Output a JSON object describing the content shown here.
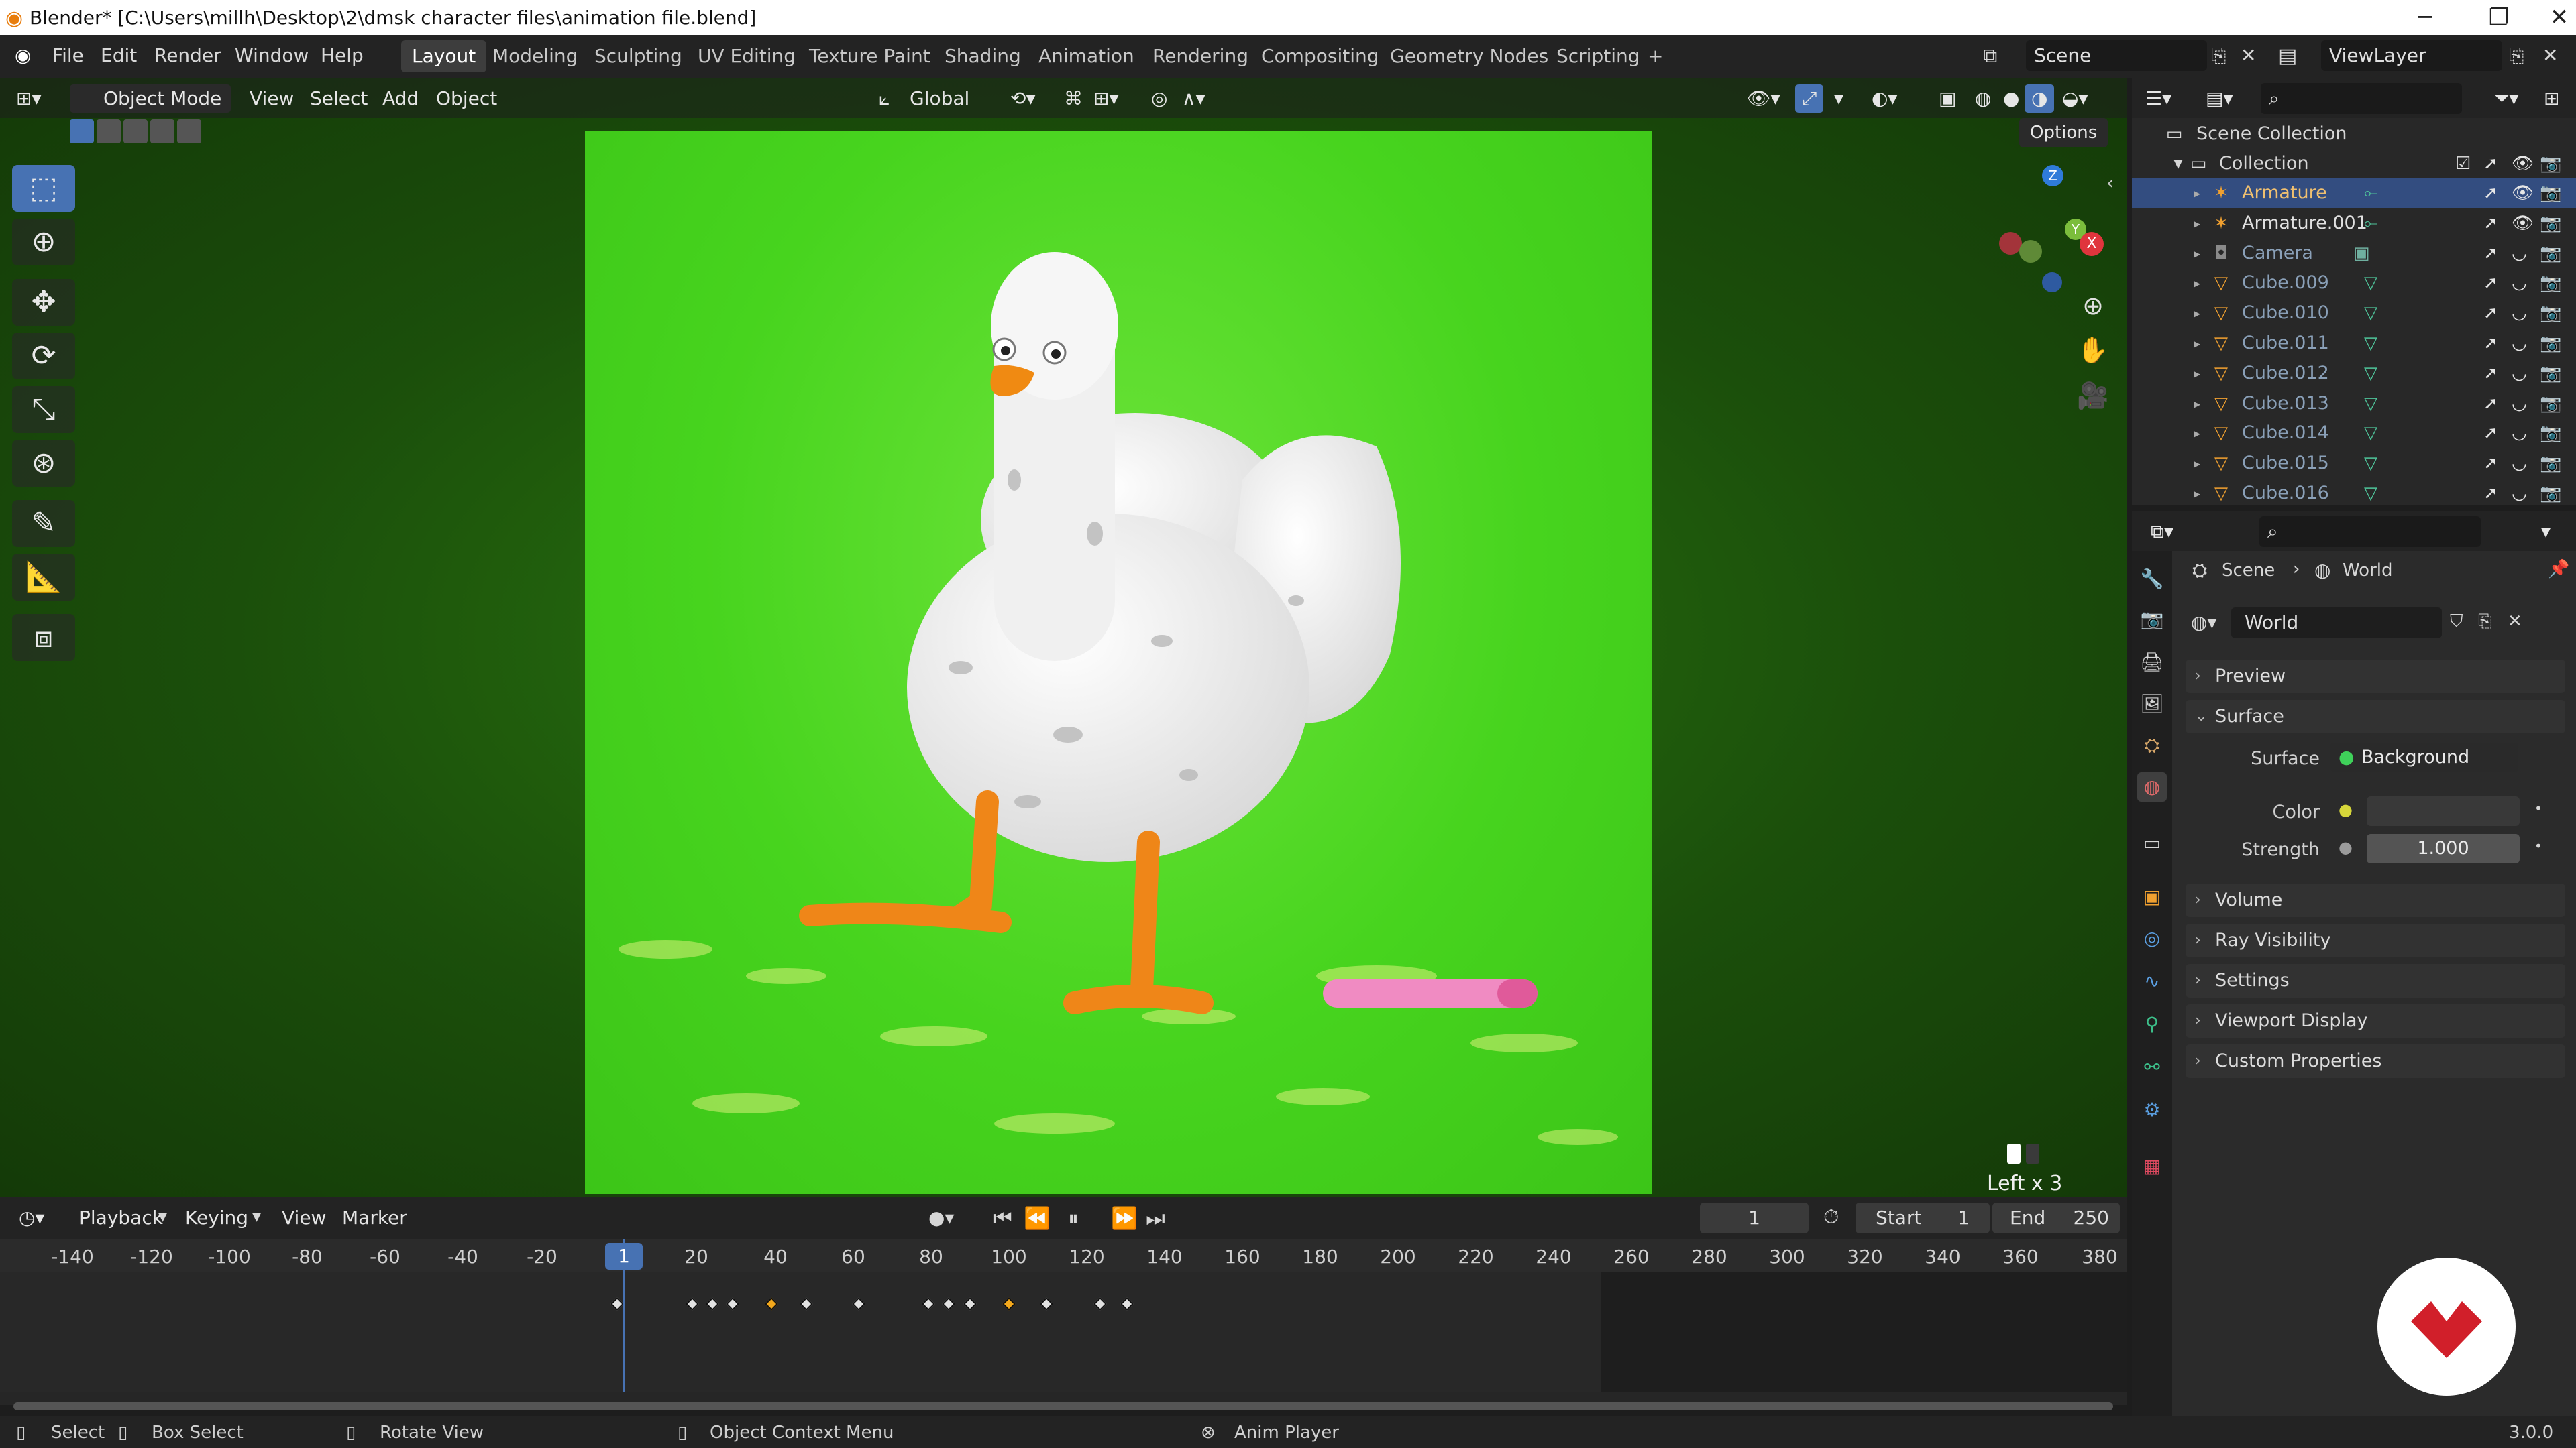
{
  "window": {
    "title": "Blender* [C:\\Users\\millh\\Desktop\\2\\dmsk character files\\animation file.blend]",
    "min": "─",
    "max": "❐",
    "close": "✕"
  },
  "menu": {
    "items": [
      "File",
      "Edit",
      "Render",
      "Window",
      "Help"
    ],
    "workspaces": [
      "Layout",
      "Modeling",
      "Sculpting",
      "UV Editing",
      "Texture Paint",
      "Shading",
      "Animation",
      "Rendering",
      "Compositing",
      "Geometry Nodes",
      "Scripting",
      "+"
    ],
    "active_workspace": "Layout",
    "scene": "Scene",
    "view_layer": "ViewLayer"
  },
  "viewport": {
    "mode": "Object Mode",
    "menus": [
      "View",
      "Select",
      "Add",
      "Object"
    ],
    "transform_orientation": "Global",
    "options_label": "Options",
    "overlay_text": "Left x 3",
    "colors": {
      "bg": "#1b4f0b",
      "frame": "#47d41e",
      "accent": "#4772b3"
    }
  },
  "timeline": {
    "menus": [
      "Playback",
      "Keying",
      "View",
      "Marker"
    ],
    "current_frame": "1",
    "start_label": "Start",
    "start": "1",
    "end_label": "End",
    "end": "250",
    "ruler_ticks": [
      "-140",
      "-120",
      "-100",
      "-80",
      "-60",
      "-40",
      "-20",
      "1",
      "20",
      "40",
      "60",
      "80",
      "100",
      "120",
      "140",
      "160",
      "180",
      "200",
      "220",
      "240",
      "260",
      "280",
      "300",
      "320",
      "340",
      "360",
      "380"
    ],
    "playhead_label": "1"
  },
  "status": {
    "select": "Select",
    "box_select": "Box Select",
    "rotate_view": "Rotate View",
    "context_menu": "Object Context Menu",
    "anim_player": "Anim Player",
    "version": "3.0.0"
  },
  "outliner": {
    "root": "Scene Collection",
    "collection": "Collection",
    "items": [
      {
        "name": "Armature",
        "selected": true
      },
      {
        "name": "Armature.001",
        "selected": false
      },
      {
        "name": "Camera",
        "selected": false
      },
      {
        "name": "Cube.009",
        "selected": false
      },
      {
        "name": "Cube.010",
        "selected": false
      },
      {
        "name": "Cube.011",
        "selected": false
      },
      {
        "name": "Cube.012",
        "selected": false
      },
      {
        "name": "Cube.013",
        "selected": false
      },
      {
        "name": "Cube.014",
        "selected": false
      },
      {
        "name": "Cube.015",
        "selected": false
      },
      {
        "name": "Cube.016",
        "selected": false
      }
    ]
  },
  "properties": {
    "breadcrumb_scene": "Scene",
    "breadcrumb_world": "World",
    "world_name": "World",
    "panels": [
      "Preview",
      "Surface",
      "Volume",
      "Ray Visibility",
      "Settings",
      "Viewport Display",
      "Custom Properties"
    ],
    "surface_label": "Surface",
    "surface_value": "Background",
    "color_label": "Color",
    "strength_label": "Strength",
    "strength_value": "1.000"
  }
}
